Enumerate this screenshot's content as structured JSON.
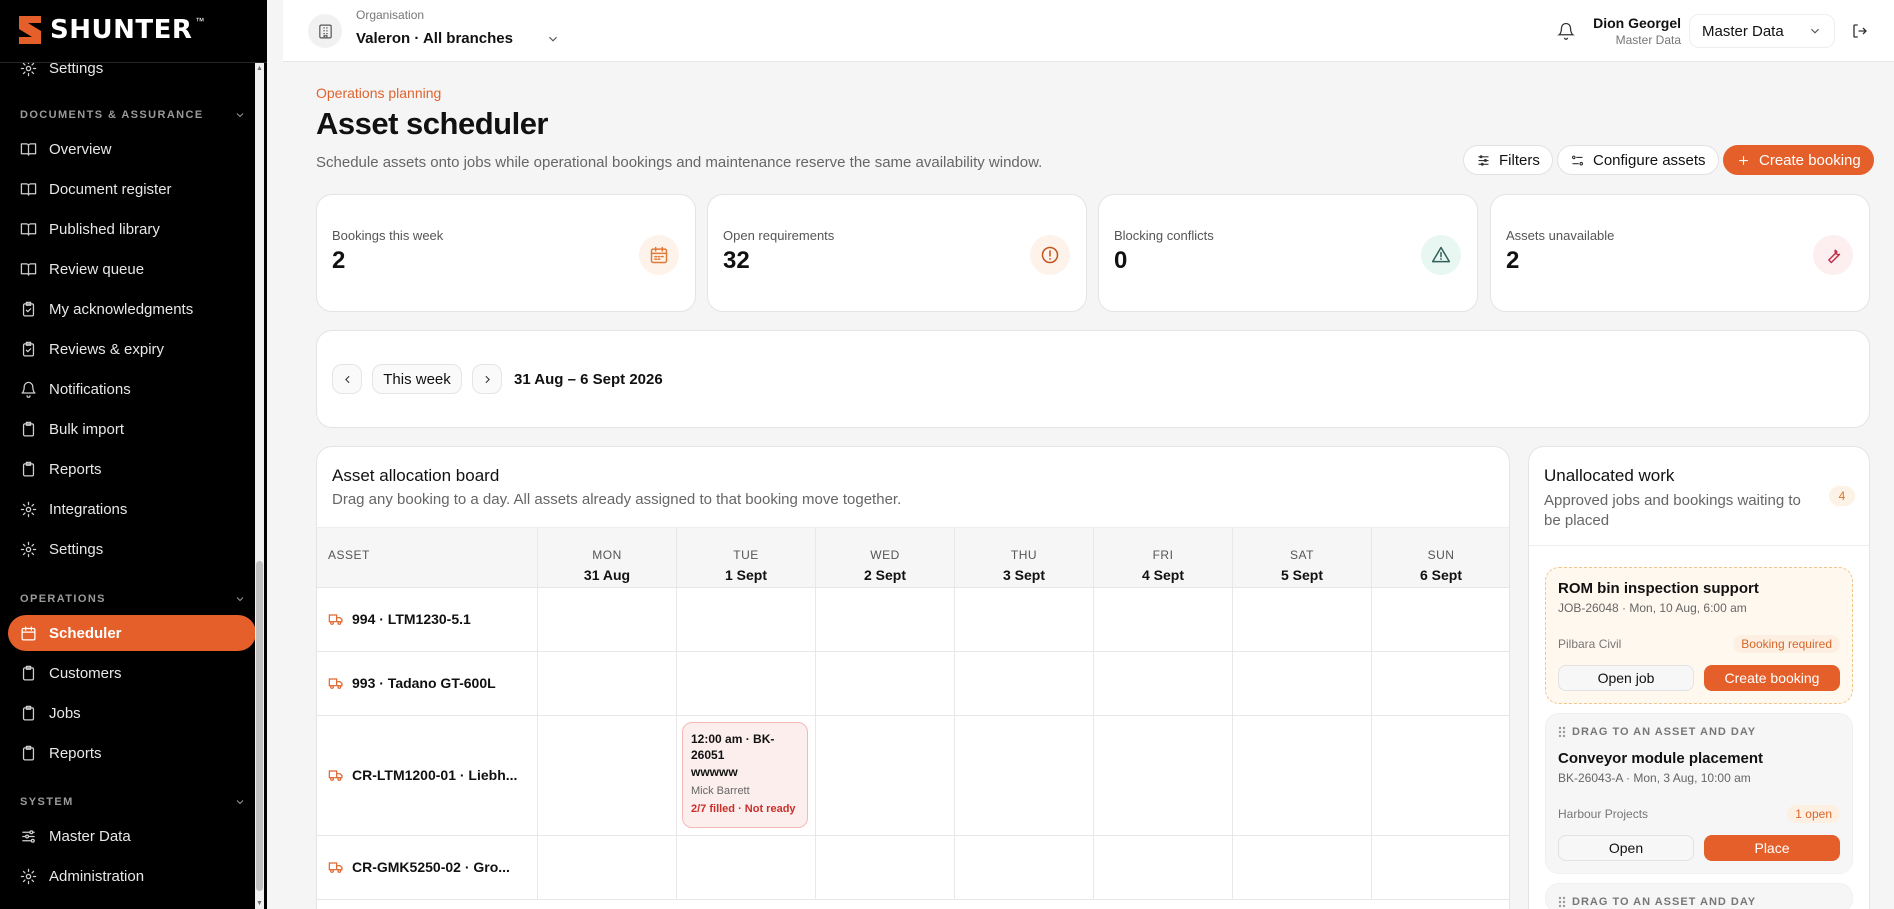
{
  "app": {
    "name": "SHUNTER",
    "tm": "™"
  },
  "colors": {
    "accent": "#e55f2a",
    "sidebar": "#000000",
    "danger": "#c8302a"
  },
  "sidebar": {
    "items_top": [
      {
        "label": "Settings",
        "icon": "gear-icon"
      }
    ],
    "sections": [
      {
        "title": "DOCUMENTS & ASSURANCE",
        "items": [
          {
            "label": "Overview",
            "icon": "book-open-icon"
          },
          {
            "label": "Document register",
            "icon": "book-open-icon"
          },
          {
            "label": "Published library",
            "icon": "book-open-icon"
          },
          {
            "label": "Review queue",
            "icon": "book-open-icon"
          },
          {
            "label": "My acknowledgments",
            "icon": "clipboard-check-icon"
          },
          {
            "label": "Reviews & expiry",
            "icon": "clipboard-check-icon"
          },
          {
            "label": "Notifications",
            "icon": "bell-icon"
          },
          {
            "label": "Bulk import",
            "icon": "clipboard-icon"
          },
          {
            "label": "Reports",
            "icon": "clipboard-icon"
          },
          {
            "label": "Integrations",
            "icon": "gear-icon"
          },
          {
            "label": "Settings",
            "icon": "gear-icon"
          }
        ]
      },
      {
        "title": "OPERATIONS",
        "items": [
          {
            "label": "Scheduler",
            "icon": "calendar-icon",
            "active": true
          },
          {
            "label": "Customers",
            "icon": "clipboard-icon"
          },
          {
            "label": "Jobs",
            "icon": "clipboard-icon"
          },
          {
            "label": "Reports",
            "icon": "clipboard-icon"
          }
        ]
      },
      {
        "title": "SYSTEM",
        "items": [
          {
            "label": "Master Data",
            "icon": "sliders-icon"
          },
          {
            "label": "Administration",
            "icon": "gear-icon"
          }
        ]
      }
    ]
  },
  "topbar": {
    "org_label": "Organisation",
    "org_value": "Valeron · All branches",
    "user_name": "Dion Georgel",
    "user_role": "Master Data",
    "data_select": "Master Data"
  },
  "header": {
    "eyebrow": "Operations planning",
    "title": "Asset scheduler",
    "description": "Schedule assets onto jobs while operational bookings and maintenance reserve the same availability window.",
    "filters_label": "Filters",
    "configure_label": "Configure assets",
    "create_label": "Create booking"
  },
  "stats": [
    {
      "label": "Bookings this week",
      "value": "2",
      "icon": "calendar-icon",
      "color": "#e07a35",
      "bg": "#fdf3ea"
    },
    {
      "label": "Open requirements",
      "value": "32",
      "icon": "alert-circle-icon",
      "color": "#c2541d",
      "bg": "#fdf3ea"
    },
    {
      "label": "Blocking conflicts",
      "value": "0",
      "icon": "warning-triangle-icon",
      "color": "#2f5f57",
      "bg": "#e9f7f3"
    },
    {
      "label": "Assets unavailable",
      "value": "2",
      "icon": "wrench-icon",
      "color": "#c2304a",
      "bg": "#fdeef0"
    }
  ],
  "week": {
    "this_week": "This week",
    "range": "31 Aug – 6 Sept 2026"
  },
  "board": {
    "title": "Asset allocation board",
    "description": "Drag any booking to a day. All assets already assigned to that booking move together.",
    "asset_header": "ASSET",
    "days": [
      {
        "dow": "MON",
        "date": "31 Aug"
      },
      {
        "dow": "TUE",
        "date": "1 Sept"
      },
      {
        "dow": "WED",
        "date": "2 Sept"
      },
      {
        "dow": "THU",
        "date": "3 Sept"
      },
      {
        "dow": "FRI",
        "date": "4 Sept"
      },
      {
        "dow": "SAT",
        "date": "5 Sept"
      },
      {
        "dow": "SUN",
        "date": "6 Sept"
      }
    ],
    "assets": [
      {
        "name": "994 · LTM1230-5.1"
      },
      {
        "name": "993 · Tadano GT-600L"
      },
      {
        "name": "CR-LTM1200-01 · Liebh..."
      },
      {
        "name": "CR-GMK5250-02 · Gro..."
      }
    ],
    "booking": {
      "title": "12:00 am · BK-26051",
      "subtitle": "wwwww",
      "person": "Mick Barrett",
      "status": "2/7 filled · Not ready"
    }
  },
  "unallocated": {
    "title": "Unallocated work",
    "description": "Approved jobs and bookings waiting to be placed",
    "count": "4",
    "cards": [
      {
        "name": "ROM bin inspection support",
        "meta": "JOB-26048 · Mon, 10 Aug, 6:00 am",
        "customer": "Pilbara Civil",
        "badge": "Booking required",
        "btn1": "Open job",
        "btn2": "Create booking"
      },
      {
        "drag": "DRAG TO AN ASSET AND DAY",
        "name": "Conveyor module placement",
        "meta": "BK-26043-A · Mon, 3 Aug, 10:00 am",
        "customer": "Harbour Projects",
        "badge": "1 open",
        "btn1": "Open",
        "btn2": "Place"
      },
      {
        "drag": "DRAG TO AN ASSET AND DAY"
      }
    ]
  }
}
